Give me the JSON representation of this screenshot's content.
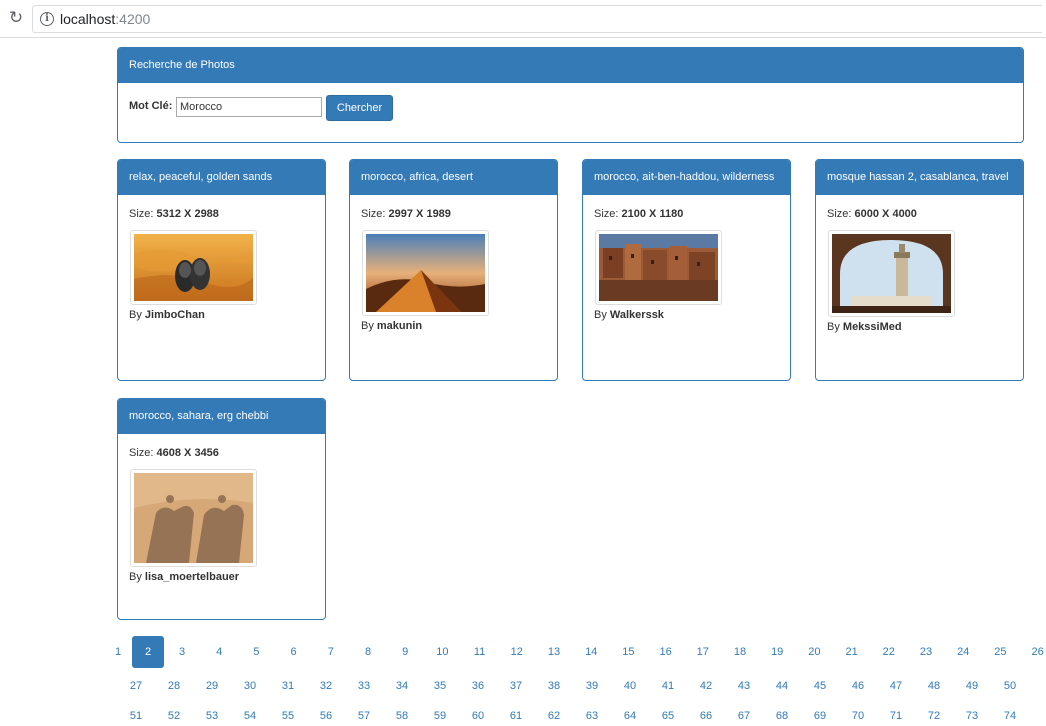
{
  "browser": {
    "url_host": "localhost",
    "url_port": ":4200"
  },
  "search": {
    "title": "Recherche de Photos",
    "label": "Mot Clé:",
    "value": "Morocco",
    "button_label": "Chercher"
  },
  "photos": [
    {
      "tags": "relax, peaceful, golden sands",
      "size_label": "Size:",
      "size": "5312 X 2988",
      "by_label": "By",
      "user": "JimboChan"
    },
    {
      "tags": "morocco, africa, desert",
      "size_label": "Size:",
      "size": "2997 X 1989",
      "by_label": "By",
      "user": "makunin"
    },
    {
      "tags": "morocco, ait-ben-haddou, wilderness",
      "size_label": "Size:",
      "size": "2100 X 1180",
      "by_label": "By",
      "user": "Walkerssk"
    },
    {
      "tags": "mosque hassan 2, casablanca, travel",
      "size_label": "Size:",
      "size": "6000 X 4000",
      "by_label": "By",
      "user": "MekssiMed"
    },
    {
      "tags": "morocco, sahara, erg chebbi",
      "size_label": "Size:",
      "size": "4608 X 3456",
      "by_label": "By",
      "user": "lisa_moertelbauer"
    }
  ],
  "pagination": {
    "current": "2",
    "row1": [
      "1",
      "2",
      "3",
      "4",
      "5",
      "6",
      "7",
      "8",
      "9",
      "10",
      "11",
      "12",
      "13",
      "14",
      "15",
      "16",
      "17",
      "18",
      "19",
      "20",
      "21",
      "22",
      "23",
      "24",
      "25",
      "26"
    ],
    "row2": [
      "27",
      "28",
      "29",
      "30",
      "31",
      "32",
      "33",
      "34",
      "35",
      "36",
      "37",
      "38",
      "39",
      "40",
      "41",
      "42",
      "43",
      "44",
      "45",
      "46",
      "47",
      "48",
      "49",
      "50"
    ],
    "row3": [
      "51",
      "52",
      "53",
      "54",
      "55",
      "56",
      "57",
      "58",
      "59",
      "60",
      "61",
      "62",
      "63",
      "64",
      "65",
      "66",
      "67",
      "68",
      "69",
      "70",
      "71",
      "72",
      "73",
      "74"
    ]
  },
  "colors": {
    "primary": "#337ab7"
  }
}
